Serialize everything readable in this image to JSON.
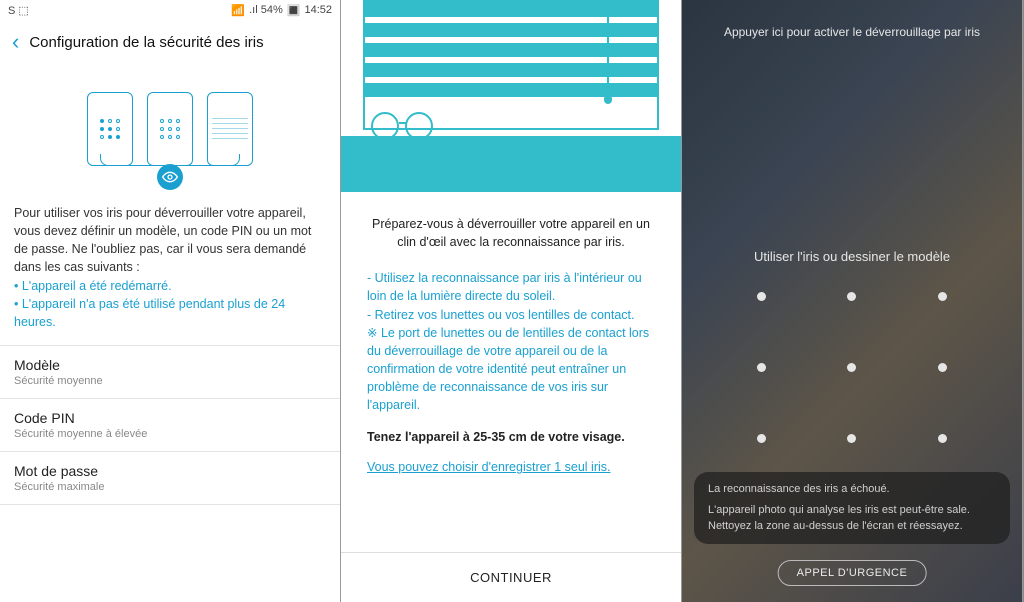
{
  "screen1": {
    "statusbar": {
      "left": "S ⬚",
      "signal": "📶",
      "battery_text": ".ıl 54%",
      "time": "14:52"
    },
    "header": {
      "title": "Configuration de la sécurité des iris"
    },
    "info": {
      "intro": "Pour utiliser vos iris pour déverrouiller votre appareil, vous devez définir un modèle, un code PIN ou un mot de passe. Ne l'oubliez pas, car il vous sera demandé dans les cas suivants :",
      "hl1": "• L'appareil a été redémarré.",
      "hl2": "• L'appareil n'a pas été utilisé pendant plus de 24 heures."
    },
    "options": [
      {
        "title": "Modèle",
        "sub": "Sécurité moyenne"
      },
      {
        "title": "Code PIN",
        "sub": "Sécurité moyenne à élevée"
      },
      {
        "title": "Mot de passe",
        "sub": "Sécurité maximale"
      }
    ]
  },
  "screen2": {
    "intro": "Préparez-vous à déverrouiller votre appareil en un clin d'œil avec la reconnaissance par iris.",
    "tip1": "- Utilisez la reconnaissance par iris à l'intérieur ou loin de la lumière directe du soleil.",
    "tip2": "- Retirez vos lunettes ou vos lentilles de contact.",
    "tip3": "※ Le port de lunettes ou de lentilles de contact lors du déverrouillage de votre appareil ou de la confirmation de votre identité peut entraîner un problème de reconnaissance de vos iris sur l'appareil.",
    "hold": "Tenez l'appareil à 25-35 cm de votre visage.",
    "link": "Vous pouvez choisir d'enregistrer 1 seul iris.",
    "continue": "CONTINUER"
  },
  "screen3": {
    "top_prompt": "Appuyer ici pour activer le déverrouillage par iris",
    "mid_prompt": "Utiliser l'iris ou dessiner le modèle",
    "toast_title": "La reconnaissance des iris a échoué.",
    "toast_body": "L'appareil photo qui analyse les iris est peut-être sale. Nettoyez la zone au-dessus de l'écran et réessayez.",
    "emergency": "APPEL D'URGENCE"
  }
}
